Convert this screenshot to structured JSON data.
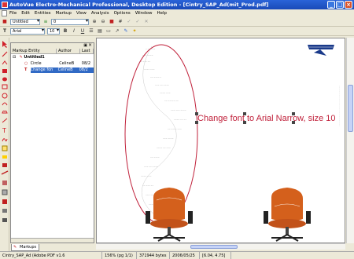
{
  "window": {
    "title": "AutoVue Electro-Mechanical Professional, Desktop Edition - [Cintry_SAP_Ad(mit_Prod.pdf]",
    "controls": [
      "minimize-icon",
      "maximize-icon",
      "close-icon"
    ]
  },
  "menubar": {
    "items": [
      "File",
      "Edit",
      "Entities",
      "Markup",
      "View",
      "Analysis",
      "Options",
      "Window",
      "Help"
    ]
  },
  "toolbar1": {
    "markup_layer": "Untitled",
    "line_width": "0"
  },
  "toolbar2": {
    "font_name": "Arial",
    "font_size": "10",
    "bold": "B",
    "italic": "I",
    "underline": "U"
  },
  "markups_panel": {
    "columns": [
      "Markup Entity",
      "Author",
      "Last"
    ],
    "tree": {
      "root": "Untitled1",
      "items": [
        {
          "name": "Circle",
          "author": "CelineB",
          "date": "08/2",
          "icon": "circle-icon"
        },
        {
          "name": "Change fon",
          "author": "CelineB",
          "date": "08/2",
          "icon": "text-icon",
          "selected": true
        }
      ]
    },
    "tab_label": "Markups"
  },
  "document": {
    "annotation_text": "Change font to Arial Narrow, size 10"
  },
  "statusbar": {
    "file": "Cintry_SAP_Ad (Adobe PDF v1.6",
    "zoom": "156% (pg 1/1)",
    "size": "371944 bytes",
    "date": "2006/05/25",
    "coords": "[6.04, 4.75]"
  },
  "colors": {
    "title_bar": "#2a63d8",
    "annotation_red": "#c0203a",
    "selection": "#316ac5",
    "chair_orange": "#d4601c"
  }
}
